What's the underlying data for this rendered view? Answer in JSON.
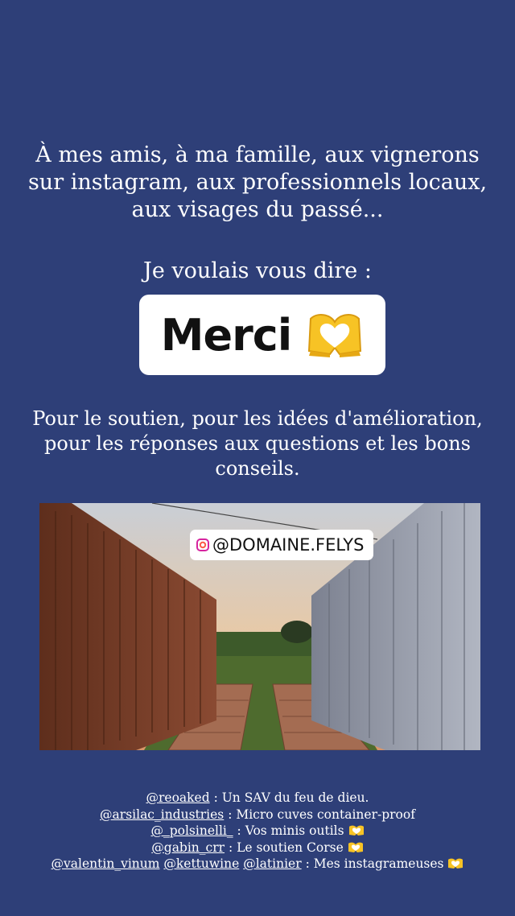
{
  "story": {
    "intro_text": "À mes amis, à ma famille, aux vignerons sur instagram, aux professionnels locaux, aux visages du passé...",
    "say_text": "Je voulais vous dire :",
    "merci_sticker": {
      "text": "Merci",
      "emoji": "heart-hands-emoji"
    },
    "support_text": "Pour le soutien, pour les idées d'amélioration, pour les réponses aux questions et les bons conseils.",
    "photo": {
      "mention_tag": "@DOMAINE.FELYS",
      "description": "photo of shipping containers at sunset"
    },
    "thanks": [
      {
        "handle": "@reoaked",
        "text": " : Un SAV du feu de dieu."
      },
      {
        "handle": "@arsilac_industries",
        "text": " : Micro cuves container-proof"
      },
      {
        "handle": "@_polsinelli_",
        "text": " : Vos minis outils "
      },
      {
        "handle": "@gabin_crr",
        "text": " : Le soutien Corse "
      },
      {
        "handles": [
          "@valentin_vinum",
          "@kettuwine",
          "@latinier"
        ],
        "text": " : Mes instagrameuses "
      }
    ]
  },
  "colors": {
    "background": "#2e3f78",
    "sticker_bg": "#ffffff",
    "emoji_yellow": "#f7c325"
  }
}
